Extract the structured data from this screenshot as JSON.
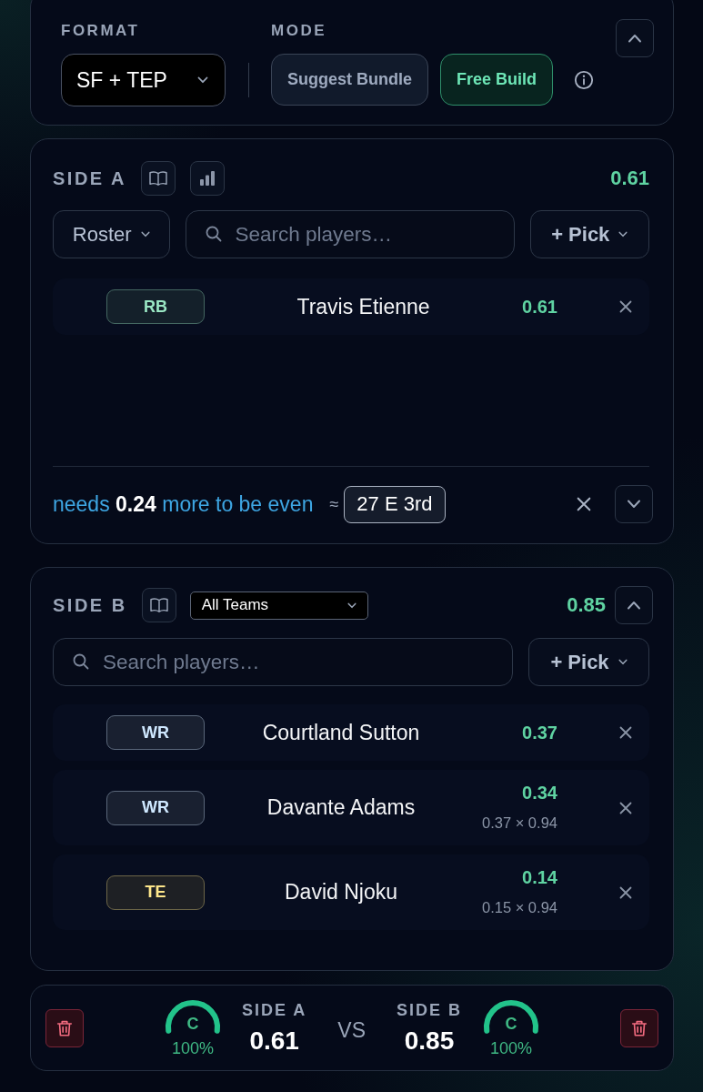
{
  "format": {
    "label": "FORMAT",
    "value": "SF + TEP"
  },
  "mode": {
    "label": "MODE",
    "options": [
      {
        "label": "Suggest Bundle",
        "selected": false
      },
      {
        "label": "Free Build",
        "selected": true
      }
    ]
  },
  "side_a": {
    "title": "SIDE A",
    "total": "0.61",
    "roster": "Roster",
    "search": {
      "placeholder": "Search players…"
    },
    "pick": "+ Pick",
    "players": [
      {
        "position": "RB",
        "color": "#9be8c5",
        "name": "Travis Etienne",
        "value": "0.61"
      }
    ],
    "hint": {
      "text": "needs **0.24** more to be even",
      "approx": "≈",
      "suggestion": "27 E 3rd"
    }
  },
  "side_b": {
    "title": "SIDE B",
    "team_filter": "All Teams",
    "total": "0.85",
    "search": {
      "placeholder": "Search players…"
    },
    "pick": "+ Pick",
    "players": [
      {
        "position": "WR",
        "color": "#cfe8ff",
        "name": "Courtland Sutton",
        "value": "0.37"
      },
      {
        "position": "WR",
        "color": "#cfe8ff",
        "name": "Davante Adams",
        "value": "0.34",
        "detail": "0.37 × 0.94"
      },
      {
        "position": "TE",
        "color": "#fde68a",
        "name": "David Njoku",
        "value": "0.14",
        "detail": "0.15 × 0.94"
      }
    ]
  },
  "summary": {
    "sides": [
      {
        "grade": "C",
        "level": 1,
        "confidence": "100%",
        "label": "SIDE A",
        "total": "0.61"
      },
      {
        "grade": "C",
        "level": 1,
        "confidence": "100%",
        "label": "SIDE B",
        "total": "0.85"
      }
    ],
    "vs": "VS"
  }
}
